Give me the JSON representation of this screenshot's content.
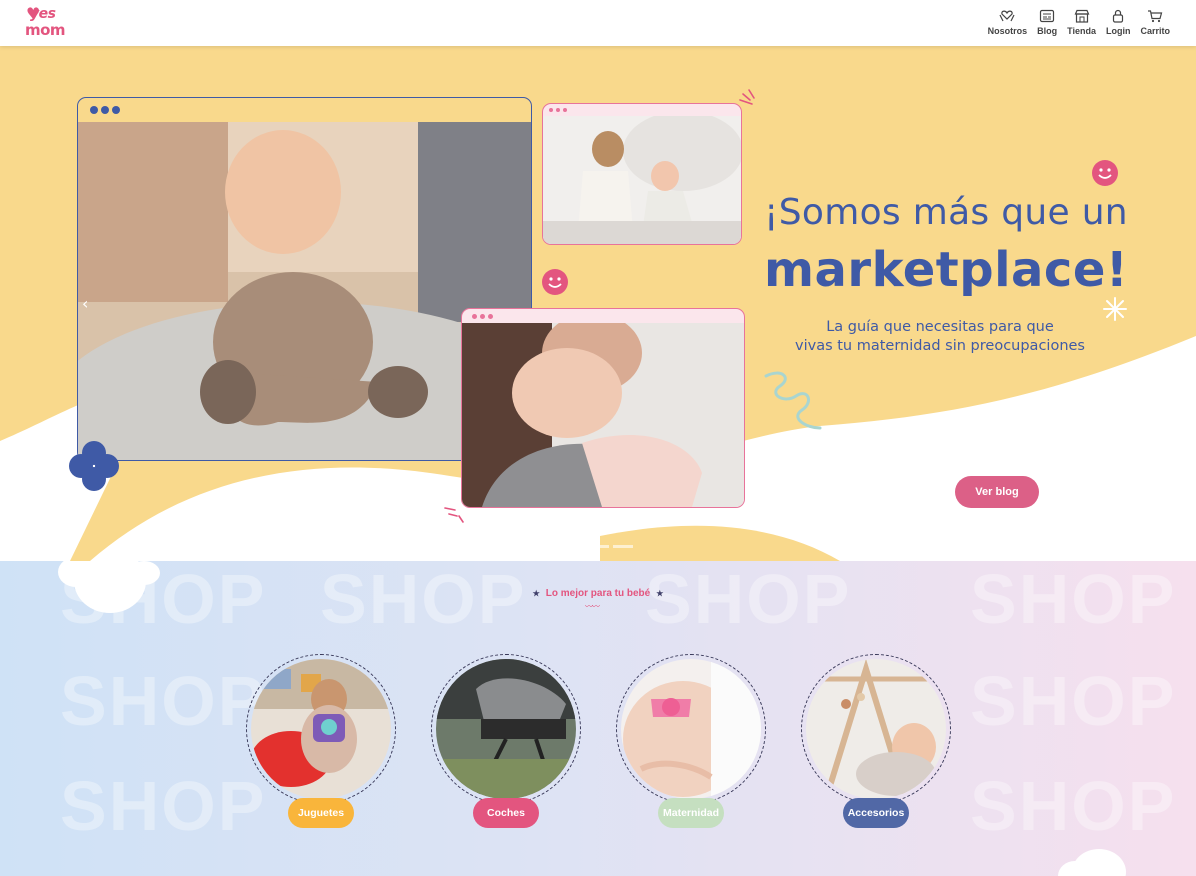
{
  "brand": {
    "line1": "yes",
    "line2": "mom",
    "color": "#e3557f"
  },
  "nav": [
    {
      "label": "Nosotros",
      "icon": "hands-heart-icon"
    },
    {
      "label": "Blog",
      "icon": "newspaper-icon"
    },
    {
      "label": "Tienda",
      "icon": "store-icon"
    },
    {
      "label": "Login",
      "icon": "lock-icon"
    },
    {
      "label": "Carrito",
      "icon": "cart-icon"
    }
  ],
  "hero": {
    "title_line1": "¡Somos más que un",
    "title_line2": "marketplace!",
    "subtitle_line1": "La guía que necesitas para que",
    "subtitle_line2": "vivas tu maternidad sin preocupaciones",
    "cta_label": "Ver blog",
    "colors": {
      "background": "#f9d98c",
      "title": "#3f5aa6",
      "cta": "#dc6087",
      "frame_blue": "#3f5aa6",
      "frame_pink": "#e8739a"
    },
    "slides_count": 3,
    "active_slide": 1
  },
  "categories": {
    "title": "Lo mejor para tu bebé",
    "background_word": "SHOP",
    "items": [
      {
        "label": "Juguetes",
        "color": "#f9b53b"
      },
      {
        "label": "Coches",
        "color": "#e3557f"
      },
      {
        "label": "Maternidad",
        "color": "#c5dfc0"
      },
      {
        "label": "Accesorios",
        "color": "#5168a6"
      }
    ]
  }
}
